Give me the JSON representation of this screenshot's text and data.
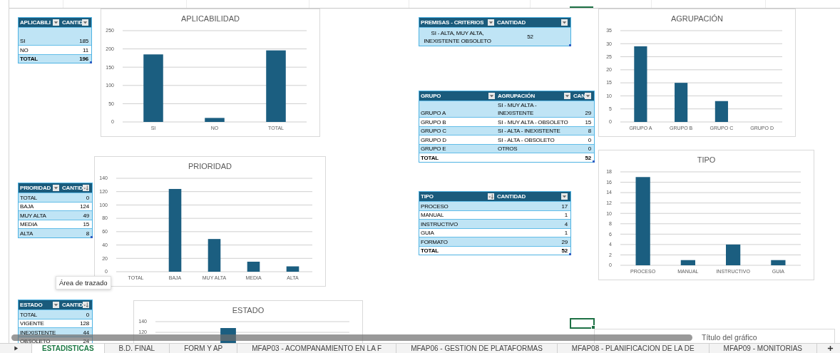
{
  "aplicabilidad_table": {
    "columns": [
      {
        "label": "APLICABILI",
        "kind": "filter"
      },
      {
        "label": "CANTID",
        "kind": "filter"
      }
    ],
    "rows": [
      {
        "kind": "data",
        "cells": [
          "SI",
          "185"
        ]
      },
      {
        "kind": "data",
        "cells": [
          "NO",
          "11"
        ]
      },
      {
        "kind": "total",
        "cells": [
          "TOTAL",
          "196"
        ]
      }
    ]
  },
  "aplicabilidad_chart": {
    "chart_data": {
      "type": "bar",
      "title": "APLICABILIDAD",
      "grid": true,
      "categories": [
        "SI",
        "NO",
        "TOTAL"
      ],
      "values": [
        185,
        11,
        196
      ],
      "ylim": [
        0,
        250
      ],
      "yticks": [
        0,
        50,
        100,
        150,
        200,
        250
      ]
    }
  },
  "premisas_table": {
    "columns": [
      {
        "label": "PREMISAS - CRITERIOS",
        "kind": "filter"
      },
      {
        "label": "CANTIDAD",
        "kind": "filter"
      }
    ],
    "rows": [
      {
        "kind": "data",
        "cells": [
          "SI - ALTA, MUY ALTA, INEXISTENTE OBSOLETO",
          "52"
        ]
      }
    ]
  },
  "agrupacion_chart": {
    "chart_data": {
      "type": "bar",
      "title": "AGRUPACIÓN",
      "grid": true,
      "categories": [
        "GRUPO A",
        "GRUPO B",
        "GRUPO C",
        "GRUPO D"
      ],
      "values": [
        29,
        15,
        8,
        0
      ],
      "ylim": [
        0,
        35
      ],
      "yticks": [
        0,
        5,
        10,
        15,
        20,
        25,
        30,
        35
      ]
    }
  },
  "grupo_table": {
    "columns": [
      {
        "label": "GRUPO",
        "kind": "filter"
      },
      {
        "label": "AGRUPACIÓN",
        "kind": "filter"
      },
      {
        "label": "CAN",
        "kind": "filter"
      }
    ],
    "rows": [
      {
        "kind": "data",
        "cells": [
          "GRUPO A",
          "SI - MUY ALTA - INEXISTENTE",
          "29"
        ]
      },
      {
        "kind": "data",
        "cells": [
          "GRUPO B",
          "SI - MUY ALTA - OBSOLETO",
          "15"
        ]
      },
      {
        "kind": "data",
        "cells": [
          "GRUPO C",
          "SI - ALTA - INEXISTENTE",
          "8"
        ]
      },
      {
        "kind": "data",
        "cells": [
          "GRUPO D",
          "SI - ALTA - OBSOLETO",
          "0"
        ]
      },
      {
        "kind": "data",
        "cells": [
          "GRUPO E",
          "OTROS",
          "0"
        ]
      },
      {
        "kind": "total",
        "cells": [
          "TOTAL",
          "",
          "52"
        ]
      }
    ]
  },
  "tipo_chart": {
    "chart_data": {
      "type": "bar",
      "title": "TIPO",
      "grid": true,
      "categories": [
        "PROCESO",
        "MANUAL",
        "INSTRUCTIVO",
        "GUIA"
      ],
      "values": [
        17,
        1,
        4,
        1
      ],
      "ylim": [
        0,
        18
      ],
      "yticks": [
        0,
        2,
        4,
        6,
        8,
        10,
        12,
        14,
        16,
        18
      ]
    }
  },
  "prioridad_chart": {
    "chart_data": {
      "type": "bar",
      "title": "PRIORIDAD",
      "grid": true,
      "categories": [
        "TOTAL",
        "BAJA",
        "MUY ALTA",
        "MEDIA",
        "ALTA"
      ],
      "values": [
        0,
        124,
        49,
        15,
        8
      ],
      "ylim": [
        0,
        140
      ],
      "yticks": [
        0,
        20,
        40,
        60,
        80,
        100,
        120,
        140
      ]
    }
  },
  "prioridad_table": {
    "columns": [
      {
        "label": "PRIORIDAD",
        "kind": "filter"
      },
      {
        "label": "CANTID",
        "kind": "sorted"
      }
    ],
    "rows": [
      {
        "kind": "data",
        "cells": [
          "TOTAL",
          "0"
        ]
      },
      {
        "kind": "data",
        "cells": [
          "BAJA",
          "124"
        ]
      },
      {
        "kind": "data",
        "cells": [
          "MUY ALTA",
          "49"
        ]
      },
      {
        "kind": "data",
        "cells": [
          "MEDIA",
          "15"
        ]
      },
      {
        "kind": "data",
        "cells": [
          "ALTA",
          "8"
        ]
      }
    ]
  },
  "tipo_table": {
    "columns": [
      {
        "label": "TIPO",
        "kind": "sorted"
      },
      {
        "label": "CANTIDAD",
        "kind": "filter"
      }
    ],
    "rows": [
      {
        "kind": "data",
        "cells": [
          "PROCESO",
          "17"
        ]
      },
      {
        "kind": "data",
        "cells": [
          "MANUAL",
          "1"
        ]
      },
      {
        "kind": "data",
        "cells": [
          "INSTRUCTIVO",
          "4"
        ]
      },
      {
        "kind": "data",
        "cells": [
          "GUIA",
          "1"
        ]
      },
      {
        "kind": "data",
        "cells": [
          "FORMATO",
          "29"
        ]
      },
      {
        "kind": "total",
        "cells": [
          "TOTAL",
          "52"
        ]
      }
    ]
  },
  "tooltip": "Área de trazado",
  "estado_table": {
    "columns": [
      {
        "label": "ESTADO",
        "kind": "filter"
      },
      {
        "label": "CANTID",
        "kind": "sorted"
      }
    ],
    "rows": [
      {
        "kind": "data",
        "cells": [
          "TOTAL",
          "0"
        ]
      },
      {
        "kind": "data",
        "cells": [
          "VIGENTE",
          "128"
        ]
      },
      {
        "kind": "data",
        "cells": [
          "INEXISTENTE",
          "44"
        ]
      },
      {
        "kind": "data",
        "cells": [
          "OBSOLETO",
          "24"
        ]
      }
    ]
  },
  "estado_chart": {
    "chart_data": {
      "type": "bar",
      "title": "ESTADO",
      "grid": true,
      "values": [
        null,
        128,
        null,
        null
      ],
      "ylim": [
        100,
        140
      ],
      "yticks": [
        120,
        140
      ]
    }
  },
  "empty_chart": {
    "title": "Título del gráfico"
  },
  "sheet_tabs": [
    {
      "label": "ESTADISTICAS",
      "selected": true
    },
    {
      "label": "B.D. FINAL",
      "selected": false
    },
    {
      "label": "FORM Y AP",
      "selected": false
    },
    {
      "label": "MFAP03 - ACOMPANAMIENTO EN LA F",
      "selected": false
    },
    {
      "label": "MFAP06 - GESTION DE PLATAFORMAS",
      "selected": false
    },
    {
      "label": "MFAP08 - PLANIFICACION DE LA DE",
      "selected": false
    },
    {
      "label": "MFAP09 - MONITORIAS",
      "selected": false
    }
  ]
}
